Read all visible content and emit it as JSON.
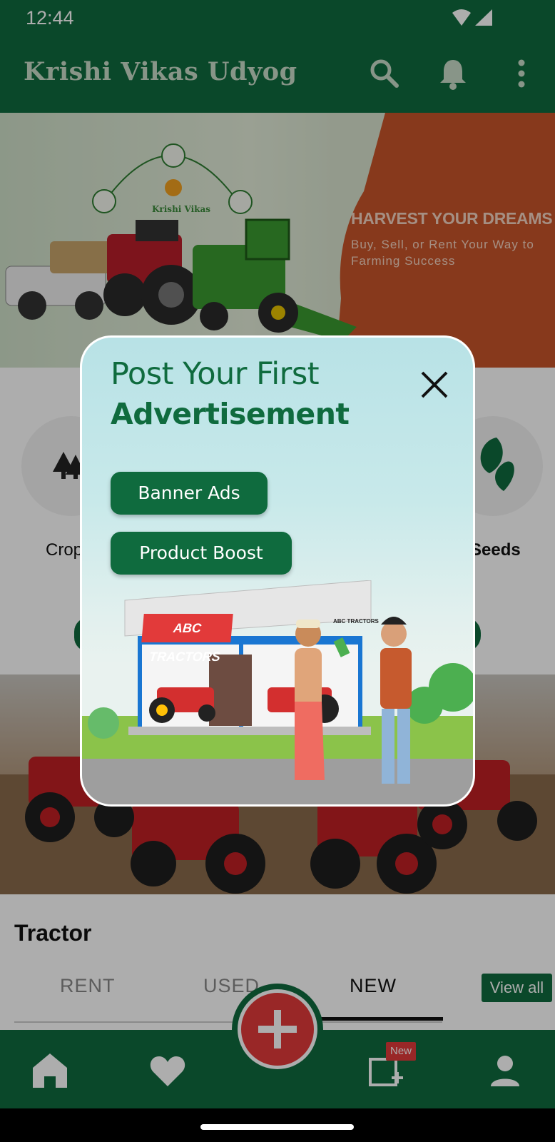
{
  "status_bar": {
    "time": "12:44"
  },
  "app_bar": {
    "title": "Krishi Vikas Udyog"
  },
  "hero": {
    "headline": "HARVEST YOUR DREAMS",
    "subtext": "Buy, Sell, or Rent Your Way to Farming Success",
    "brand": "Krishi Vikas"
  },
  "categories": [
    {
      "label": "Crop"
    },
    {
      "label": "Seeds"
    }
  ],
  "tractor_section": {
    "title": "Tractor",
    "tabs": [
      "RENT",
      "USED",
      "NEW"
    ],
    "active_tab": "NEW",
    "view_all": "View all"
  },
  "bottom_nav": {
    "items": [
      "home-icon",
      "favorite-icon",
      "post-ad-icon",
      "profile-icon"
    ],
    "new_badge": "New",
    "fab_icon": "plus-icon"
  },
  "modal": {
    "title_line1": "Post Your First",
    "title_line2": "Advertisement",
    "buttons": [
      "Banner Ads",
      "Product Boost"
    ],
    "sign_text": "ABC TRACTORS",
    "small_sign_text": "ABC TRACTORS"
  },
  "colors": {
    "primary": "#0f6b3e",
    "accent": "#e23a3a",
    "hero_orange": "#c8552a"
  }
}
